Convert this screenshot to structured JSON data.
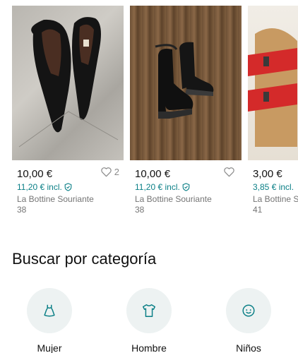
{
  "products": [
    {
      "price": "10,00 €",
      "price_incl": "11,20 € incl.",
      "brand": "La Bottine Souriante",
      "size": "38",
      "favorites": "2",
      "image_icon": "black-pumps-image"
    },
    {
      "price": "10,00 €",
      "price_incl": "11,20 € incl.",
      "brand": "La Bottine Souriante",
      "size": "38",
      "favorites": "",
      "image_icon": "black-ankle-boots-image"
    },
    {
      "price": "3,00 €",
      "price_incl": "3,85 € incl.",
      "brand": "La Bottine S",
      "size": "41",
      "favorites": "",
      "image_icon": "red-sandals-image"
    }
  ],
  "category_section": {
    "title": "Buscar por categoría",
    "items": [
      {
        "label": "Mujer",
        "icon": "dress-icon"
      },
      {
        "label": "Hombre",
        "icon": "tshirt-icon"
      },
      {
        "label": "Niños",
        "icon": "child-face-icon"
      }
    ]
  },
  "colors": {
    "accent": "#0a7f86",
    "category_circle": "#edf2f2",
    "muted_text": "#757575"
  }
}
